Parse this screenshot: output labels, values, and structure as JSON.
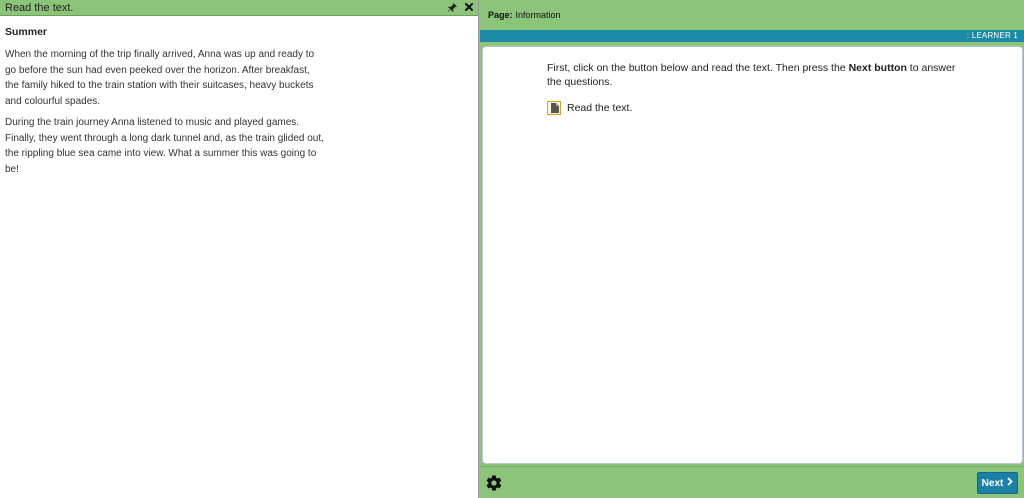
{
  "reader": {
    "window_title": "Read the text.",
    "title": "Summer",
    "paragraphs": [
      "When the morning of the trip finally arrived, Anna was up and ready to go before the sun had even peeked over the horizon. After breakfast, the family hiked to the train station with their suitcases, heavy buckets and colourful spades.",
      "During the train journey Anna listened to music and played games. Finally, they went through a long dark tunnel and, as the train glided out, the rippling blue sea came into view. What a summer this was going to be!"
    ],
    "icons": [
      "pin-icon",
      "close-icon"
    ]
  },
  "header": {
    "page_label": "Page:",
    "page_name": "Information"
  },
  "learner": {
    "label": ": LEARNER 1"
  },
  "content": {
    "instruction_before": "First, click on the button below and read the text. Then press the ",
    "instruction_bold": "Next button",
    "instruction_after": " to answer the questions.",
    "read_button_label": "Read the text.",
    "read_button_icon": "document-icon"
  },
  "footer": {
    "settings_icon": "gear-icon",
    "next_label": "Next",
    "next_icon": "chevron-right-icon"
  },
  "colors": {
    "green": "#8cc47a",
    "teal": "#1a8aa6",
    "button_blue": "#1a80a6"
  }
}
